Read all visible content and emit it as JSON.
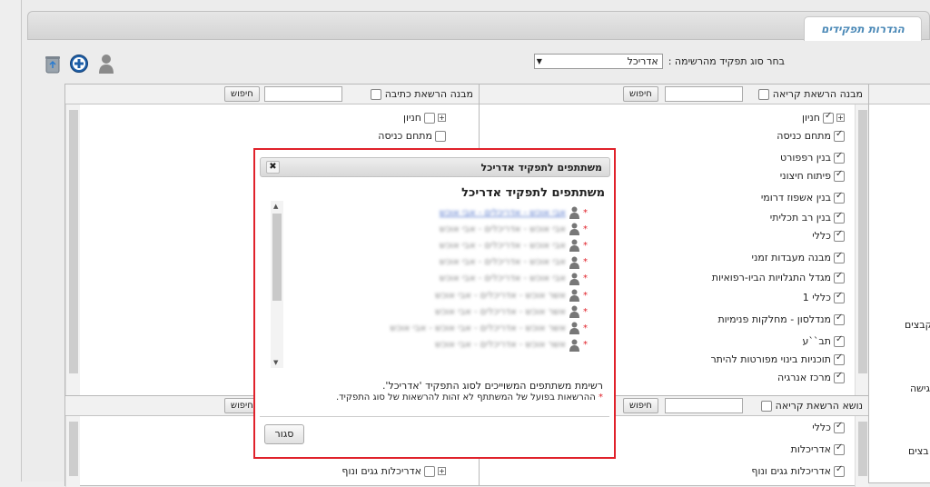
{
  "tab": {
    "label": "הגדרות תפקידים"
  },
  "toolbar": {
    "select_label": "בחר סוג תפקיד מהרשימה :",
    "select_value": "אדריכל"
  },
  "right_top": {
    "title": "מבנה הרשאת קריאה",
    "search_label": "חיפוש",
    "items": [
      "חניון",
      "מתחם כניסה",
      "בנין רפפורט",
      "פיתוח חיצוני",
      "בנין אשפוז דרומי",
      "בנין רב תכליתי",
      "כללי",
      "מבנה מעבדות זמני",
      "מגדל התגלויות הביו-רפואיות",
      "כללי 1",
      "מנדלסון - מחלקות פנימיות",
      "תב``ע",
      "תוכניות בינוי מפורטות להיתר",
      "מרכז אנרגיה"
    ]
  },
  "left_top": {
    "title": "מבנה הרשאת כתיבה",
    "search_label": "חיפוש",
    "items": [
      "חניון",
      "מתחם כניסה"
    ]
  },
  "right_bottom": {
    "title": "נושא הרשאת קריאה",
    "search_label": "חיפוש",
    "items": [
      "כללי",
      "אדריכלות",
      "אדריכלות גגים ונוף"
    ]
  },
  "left_bottom": {
    "search_label": "חיפוש",
    "items": [
      "אדריכלות גגים ונוף"
    ]
  },
  "side": {
    "t1": "קבצים",
    "t2": "גישה",
    "t3": "בצים"
  },
  "modal": {
    "header": "משתתפים לתפקיד אדריכל",
    "title": "משתתפים לתפקיד אדריכל",
    "note_line1": "רשימת משתתפים המשוייכים לסוג התפקיד 'אדריכל'.",
    "note_star": "*",
    "note_line2": "ההרשאות בפועל של המשתתף לא זהות להרשאות של סוג התפקיד.",
    "close_label": "סגור",
    "participants": [
      "אבי אוכש - אדריכלים - אבי אוכש",
      "אבי אוכש - אדריכלים - אבי אוכש",
      "אבי אוכש - אדריכלים - אבי אוכש",
      "אבי אוכש - אדריכלים - אבי אוכש",
      "אבי אוכש - אדריכלים - אבי אוכש",
      "אשר אוכש - אדריכלים - אבי אוכש",
      "אשר אוכש - אדריכלים - אבי אוכש",
      "אשר אוכש - אדריכלים - אבי אוכש - אבי אוכש",
      "אשר אוכש - אדריכלים - אבי אוכש"
    ]
  }
}
